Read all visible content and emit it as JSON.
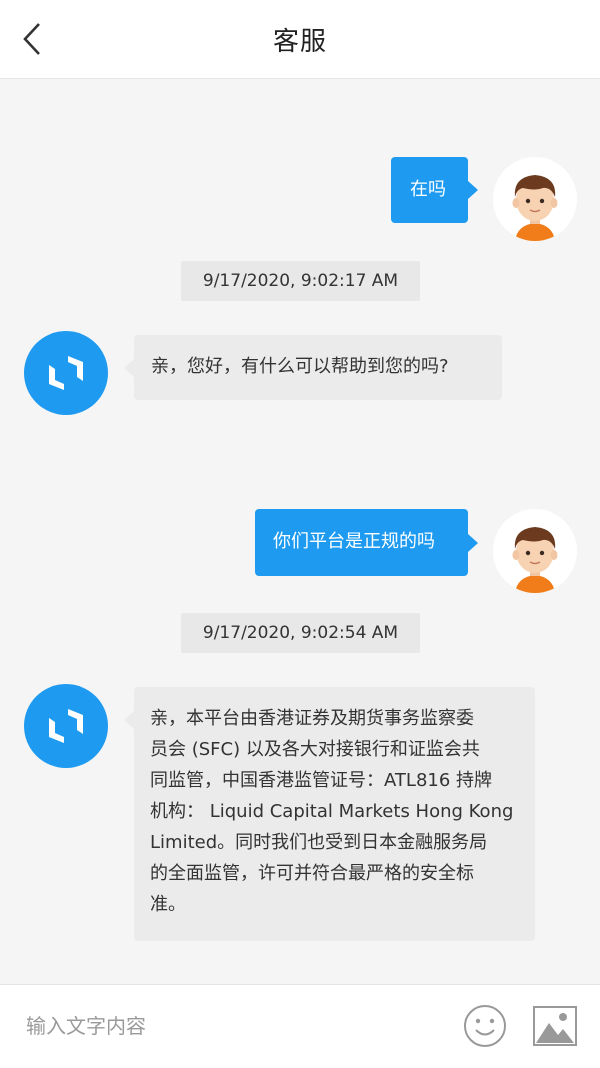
{
  "header": {
    "title": "客服"
  },
  "messages": [
    {
      "text": "在吗"
    },
    {
      "timestamp": "9/17/2020, 9:02:17 AM",
      "text": "亲，您好，有什么可以帮助到您的吗?"
    },
    {
      "text": "你们平台是正规的吗"
    },
    {
      "timestamp": "9/17/2020, 9:02:54 AM",
      "lines": [
        "亲，本平台由香港证券及期货事务监察委",
        "员会 (SFC) 以及各大对接银行和证监会共",
        "同监管，中国香港监管证号：ATL816 持牌",
        "机构： Liquid Capital Markets Hong Kong",
        "Limited。同时我们也受到日本金融服务局",
        "的全面监管，许可并符合最严格的安全标",
        "准。"
      ]
    }
  ],
  "input": {
    "placeholder": "输入文字内容"
  },
  "icons": {
    "back": "chevron-left-icon",
    "emoji": "smiley-icon",
    "image": "image-icon",
    "user_avatar": "boy-avatar-icon",
    "bot_avatar": "support-logo-icon"
  },
  "colors": {
    "accent": "#1e9bf0",
    "incoming_bubble": "#ebebeb",
    "background": "#f5f5f5"
  }
}
